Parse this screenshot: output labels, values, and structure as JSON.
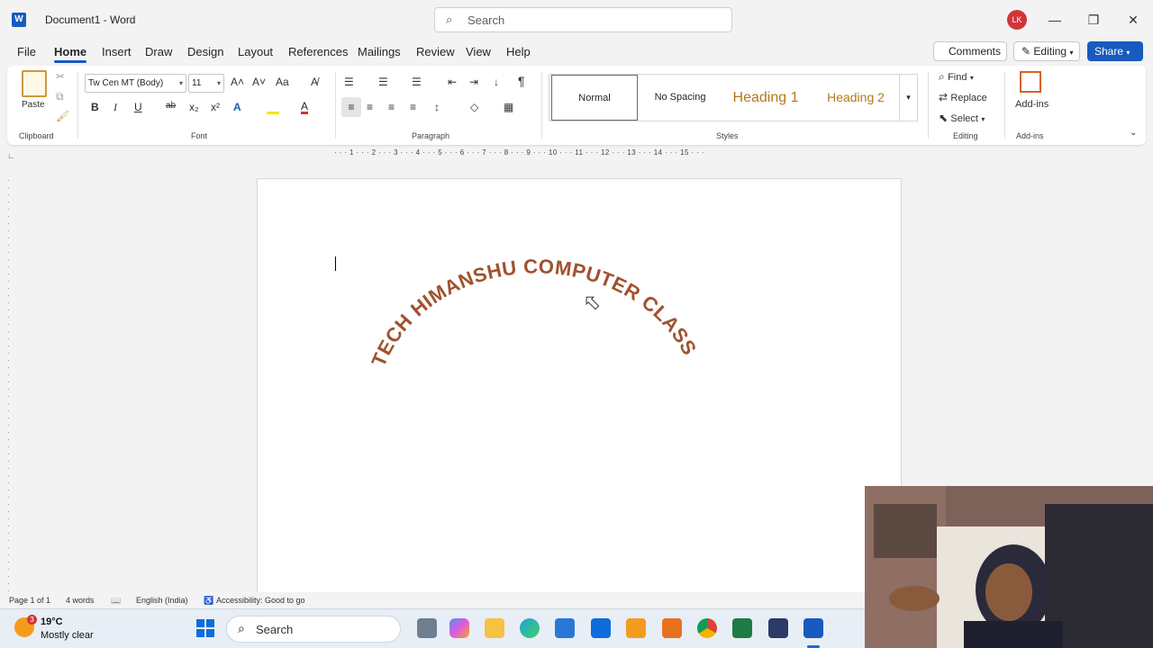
{
  "titlebar": {
    "app_logo": "W",
    "title": "Document1  -  Word",
    "search_placeholder": "Search",
    "avatar_initials": "LK",
    "minimize": "—",
    "restore": "❐",
    "close": "✕"
  },
  "menu": {
    "tabs": [
      "File",
      "Home",
      "Insert",
      "Draw",
      "Design",
      "Layout",
      "References",
      "Mailings",
      "Review",
      "View",
      "Help"
    ],
    "active": "Home",
    "comments_label": "Comments",
    "editing_label": "Editing",
    "share_label": "Share"
  },
  "ribbon": {
    "clipboard": {
      "paste_label": "Paste",
      "group_label": "Clipboard"
    },
    "font": {
      "font_name": "Tw Cen MT (Body)",
      "font_size": "11",
      "grow": "A˄",
      "shrink": "A˅",
      "change_case": "Aa",
      "bold": "B",
      "italic": "I",
      "underline": "U",
      "strike": "ab",
      "subscript": "x₂",
      "superscript": "x²",
      "text_effects": "A",
      "font_color": "A",
      "group_label": "Font"
    },
    "paragraph": {
      "group_label": "Paragraph",
      "show_marks": "¶"
    },
    "styles": {
      "items": [
        "Normal",
        "No Spacing",
        "Heading 1",
        "Heading 2"
      ],
      "group_label": "Styles"
    },
    "editing": {
      "find": "Find",
      "replace": "Replace",
      "select": "Select",
      "group_label": "Editing"
    },
    "addins": {
      "label": "Add-ins",
      "group_label": "Add-ins"
    }
  },
  "ruler": {
    "marks": "· · · 1 · · · 2 · · · 3 · · · 4 · · · 5 · · · 6 · · · 7 · · · 8 · · · 9 · · · 10 · · · 11 · · · 12 · · · 13 · · · 14 · · · 15 · · ·"
  },
  "document": {
    "wordart_text": "TECH HIMANSHU COMPUTER CLASS",
    "wordart_color": "#a0522d"
  },
  "statusbar": {
    "page": "Page 1 of 1",
    "words": "4 words",
    "language": "English (India)",
    "accessibility": "Accessibility: Good to go"
  },
  "taskbar": {
    "weather_badge": "3",
    "temperature": "19°C",
    "weather": "Mostly clear",
    "search_label": "Search"
  }
}
